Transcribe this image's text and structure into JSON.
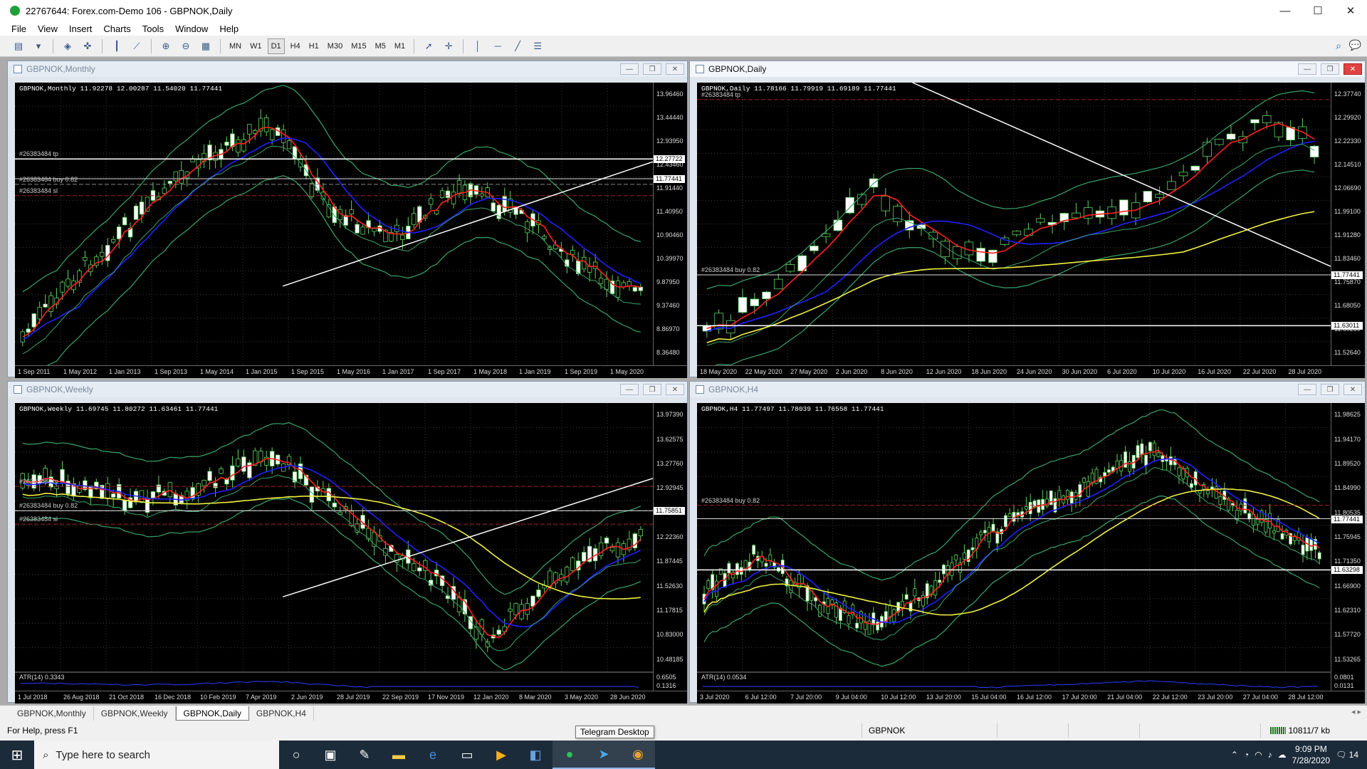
{
  "window": {
    "title": "22767644: Forex.com-Demo 106 - GBPNOK,Daily"
  },
  "menu": [
    "File",
    "View",
    "Insert",
    "Charts",
    "Tools",
    "Window",
    "Help"
  ],
  "toolbar": {
    "timeframes": [
      "MN",
      "W1",
      "D1",
      "H4",
      "H1",
      "M30",
      "M15",
      "M5",
      "M1"
    ]
  },
  "colors": {
    "candle": "#5fd35f",
    "ma_fast": "#ff2020",
    "ma_mid": "#2020ff",
    "ma_slow": "#f0f040",
    "bands": "#3aa36a",
    "order_line": "#a02020"
  },
  "charts": [
    {
      "id": "monthly",
      "caption": "GBPNOK,Monthly",
      "symbol_line": "GBPNOK,Monthly  11.92278 12.00287 11.54020 11.77441",
      "price_ticks": [
        "13.96460",
        "13.44440",
        "12.93950",
        "12.43460",
        "11.91440",
        "11.40950",
        "10.90460",
        "10.39970",
        "9.87950",
        "9.37460",
        "8.86970",
        "8.36480"
      ],
      "current_price": "11.77441",
      "extra_price": "12.27722",
      "time_ticks": [
        "1 Sep 2011",
        "1 May 2012",
        "1 Jan 2013",
        "1 Sep 2013",
        "1 May 2014",
        "1 Jan 2015",
        "1 Sep 2015",
        "1 May 2016",
        "1 Jan 2017",
        "1 Sep 2017",
        "1 May 2018",
        "1 Jan 2019",
        "1 Sep 2019",
        "1 May 2020"
      ],
      "orders": [
        "#26383484 tp",
        "#26383484 buy 0.82",
        "#26383484 sl"
      ]
    },
    {
      "id": "daily",
      "caption": "GBPNOK,Daily",
      "symbol_line": "GBPNOK,Daily  11.78166 11.79919 11.69189 11.77441",
      "price_ticks": [
        "12.37740",
        "12.29920",
        "12.22330",
        "12.14510",
        "12.06690",
        "11.99100",
        "11.91280",
        "11.83460",
        "11.75870",
        "11.68050",
        "11.60230",
        "11.52640"
      ],
      "current_price": "11.77441",
      "extra_price": "11.63011",
      "time_ticks": [
        "18 May 2020",
        "22 May 2020",
        "27 May 2020",
        "2 Jun 2020",
        "8 Jun 2020",
        "12 Jun 2020",
        "18 Jun 2020",
        "24 Jun 2020",
        "30 Jun 2020",
        "6 Jul 2020",
        "10 Jul 2020",
        "16 Jul 2020",
        "22 Jul 2020",
        "28 Jul 2020"
      ],
      "orders": [
        "#26383484 tp",
        "#26383484 buy 0.82"
      ]
    },
    {
      "id": "weekly",
      "caption": "GBPNOK,Weekly",
      "symbol_line": "GBPNOK,Weekly  11.69745 11.80272 11.63461 11.77441",
      "price_ticks": [
        "13.97390",
        "13.62575",
        "13.27760",
        "12.92945",
        "12.58130",
        "12.22360",
        "11.87445",
        "11.52630",
        "11.17815",
        "10.83000",
        "10.48185"
      ],
      "current_price": "11.75851",
      "time_ticks": [
        "1 Jul 2018",
        "26 Aug 2018",
        "21 Oct 2018",
        "16 Dec 2018",
        "10 Feb 2019",
        "7 Apr 2019",
        "2 Jun 2019",
        "28 Jul 2019",
        "22 Sep 2019",
        "17 Nov 2019",
        "12 Jan 2020",
        "8 Mar 2020",
        "3 May 2020",
        "28 Jun 2020"
      ],
      "orders": [
        "#26383484 tp",
        "#26383484 buy 0.82",
        "#26383484 sl"
      ],
      "indicator": "ATR(14) 0.3343",
      "indicator_ticks": [
        "0.6505",
        "0.1316"
      ]
    },
    {
      "id": "h4",
      "caption": "GBPNOK,H4",
      "symbol_line": "GBPNOK,H4  11.77497 11.78039 11.76558 11.77441",
      "price_ticks": [
        "11.98625",
        "11.94170",
        "11.89520",
        "11.84990",
        "11.80535",
        "11.75945",
        "11.71350",
        "11.66900",
        "11.62310",
        "11.57720",
        "11.53265"
      ],
      "current_price": "11.77441",
      "extra_price": "11.63298",
      "time_ticks": [
        "3 Jul 2020",
        "6 Jul 12:00",
        "7 Jul 20:00",
        "9 Jul 04:00",
        "10 Jul 12:00",
        "13 Jul 20:00",
        "15 Jul 04:00",
        "16 Jul 12:00",
        "17 Jul 20:00",
        "21 Jul 04:00",
        "22 Jul 12:00",
        "23 Jul 20:00",
        "27 Jul 04:00",
        "28 Jul 12:00"
      ],
      "orders": [
        "#26383484 buy 0.82"
      ],
      "indicator": "ATR(14) 0.0534",
      "indicator_ticks": [
        "0.0801",
        "0.0131"
      ]
    }
  ],
  "tabs": [
    "GBPNOK,Monthly",
    "GBPNOK,Weekly",
    "GBPNOK,Daily",
    "GBPNOK,H4"
  ],
  "active_tab": "GBPNOK,Daily",
  "status": {
    "help": "For Help, press F1",
    "symbol": "GBPNOK",
    "traffic": "10811/7 kb"
  },
  "tooltip": "Telegram Desktop",
  "taskbar": {
    "search_placeholder": "Type here to search",
    "time": "9:09 PM",
    "date": "7/28/2020",
    "notifications": "14"
  }
}
